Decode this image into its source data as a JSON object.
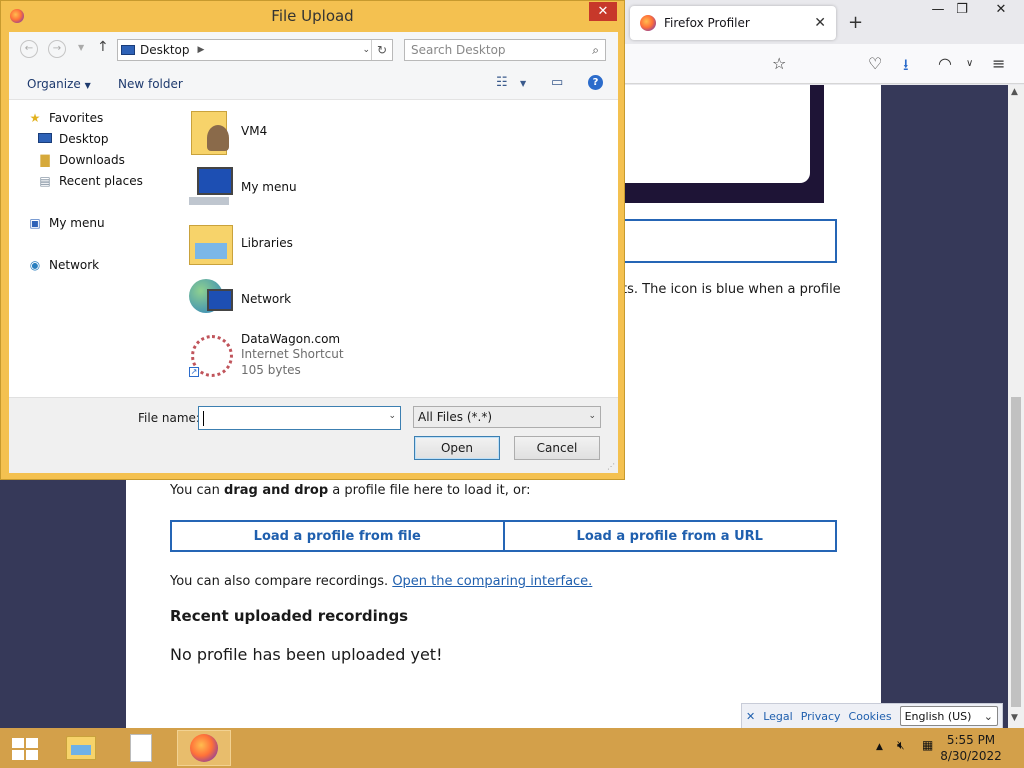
{
  "browser": {
    "tab_title": "Firefox Profiler",
    "tab_close": "✕",
    "new_tab": "+",
    "window_controls": {
      "minimize": "—",
      "restore": "❐",
      "close": "✕"
    }
  },
  "page": {
    "intro_tail": "ts. The icon is blue when a profile",
    "drag_prefix": "You can ",
    "drag_bold": "drag and drop",
    "drag_suffix": " a profile file here to load it, or:",
    "load_file": "Load a profile from file",
    "load_url": "Load a profile from a URL",
    "compare_prefix": "You can also compare recordings. ",
    "compare_link": "Open the comparing interface.",
    "recent_heading": "Recent uploaded recordings",
    "no_profile": "No profile has been uploaded yet!"
  },
  "footer": {
    "close": "✕",
    "legal": "Legal",
    "privacy": "Privacy",
    "cookies": "Cookies",
    "language": "English (US)"
  },
  "dialog": {
    "title": "File Upload",
    "close": "✕",
    "address": "Desktop",
    "search_placeholder": "Search Desktop",
    "organize": "Organize",
    "new_folder": "New folder",
    "help": "?",
    "nav_pane": {
      "favorites": "Favorites",
      "desktop": "Desktop",
      "downloads": "Downloads",
      "recent_places": "Recent places",
      "my_menu": "My menu",
      "network": "Network"
    },
    "files": [
      {
        "name": "VM4"
      },
      {
        "name": "My menu"
      },
      {
        "name": "Libraries"
      },
      {
        "name": "Network"
      },
      {
        "name": "DataWagon.com",
        "type": "Internet Shortcut",
        "size": "105 bytes"
      }
    ],
    "file_name_label": "File name:",
    "file_name_value": "",
    "filter": "All Files (*.*)",
    "open": "Open",
    "cancel": "Cancel"
  },
  "taskbar": {
    "time": "5:55 PM",
    "date": "8/30/2022"
  }
}
